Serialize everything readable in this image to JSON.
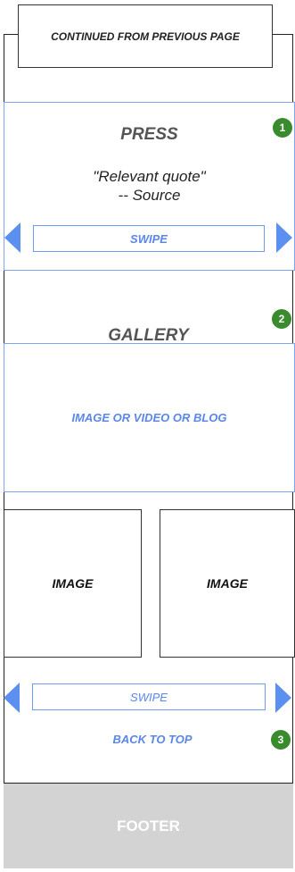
{
  "header": {
    "continued_label": "CONTINUED FROM PREVIOUS PAGE"
  },
  "press": {
    "title": "PRESS",
    "quote": "\"Relevant quote\"",
    "source": "-- Source",
    "swipe_label": "SWIPE",
    "badge": "1"
  },
  "gallery": {
    "title": "GALLERY",
    "badge": "2",
    "media_label": "IMAGE OR VIDEO OR BLOG",
    "images": [
      {
        "label": "IMAGE"
      },
      {
        "label": "IMAGE"
      }
    ],
    "swipe_label": "SWIPE"
  },
  "back_to_top": {
    "label": "BACK TO TOP",
    "badge": "3"
  },
  "footer": {
    "label": "FOOTER"
  },
  "colors": {
    "accent_blue": "#5b8ff0",
    "badge_green": "#3a8a2e",
    "footer_gray": "#d3d3d3"
  },
  "icons": {
    "swipe_prev": "arrow-left-icon",
    "swipe_next": "arrow-right-icon"
  }
}
